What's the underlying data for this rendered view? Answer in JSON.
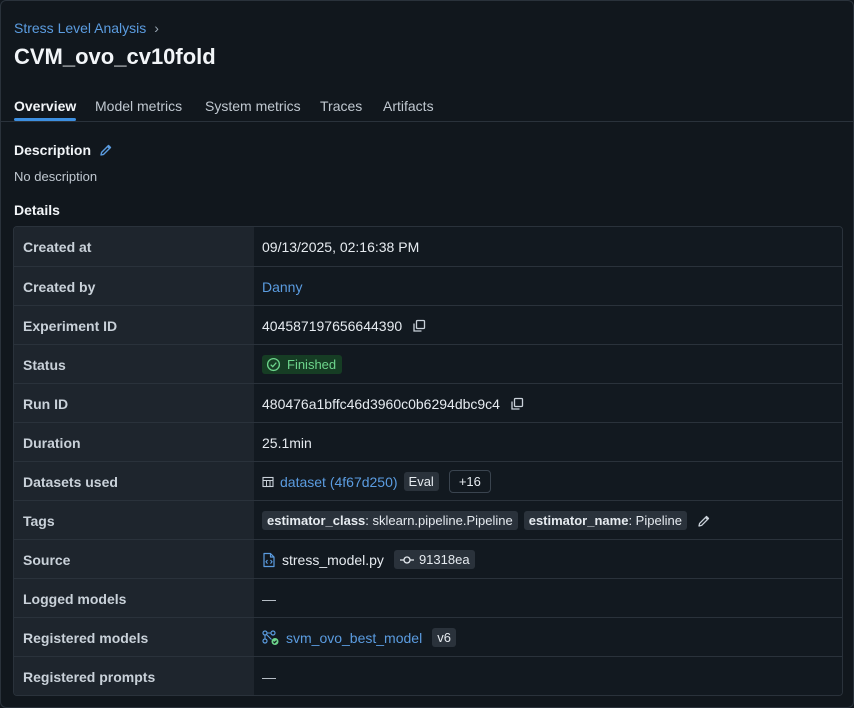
{
  "breadcrumb": {
    "experiment": "Stress Level Analysis"
  },
  "run_title": "CVM_ovo_cv10fold",
  "tabs": [
    "Overview",
    "Model metrics",
    "System metrics",
    "Traces",
    "Artifacts"
  ],
  "description": {
    "label": "Description",
    "value": "No description"
  },
  "details_label": "Details",
  "details": {
    "created_at": {
      "key": "Created at",
      "value": "09/13/2025, 02:16:38 PM"
    },
    "created_by": {
      "key": "Created by",
      "value": "Danny"
    },
    "experiment_id": {
      "key": "Experiment ID",
      "value": "404587197656644390"
    },
    "status": {
      "key": "Status",
      "value": "Finished"
    },
    "run_id": {
      "key": "Run ID",
      "value": "480476a1bffc46d3960c0b6294dbc9c4"
    },
    "duration": {
      "key": "Duration",
      "value": "25.1min"
    },
    "datasets_used": {
      "key": "Datasets used",
      "dataset": "dataset (4f67d250)",
      "context": "Eval",
      "more": "+16"
    },
    "tags": {
      "key": "Tags",
      "items": [
        {
          "name": "estimator_class",
          "value": "sklearn.pipeline.Pipeline"
        },
        {
          "name": "estimator_name",
          "value": "Pipeline"
        }
      ]
    },
    "source": {
      "key": "Source",
      "file": "stress_model.py",
      "commit": "91318ea"
    },
    "logged_models": {
      "key": "Logged models",
      "value": "—"
    },
    "registered_models": {
      "key": "Registered models",
      "model": "svm_ovo_best_model",
      "version": "v6"
    },
    "registered_prompts": {
      "key": "Registered prompts",
      "value": "—"
    }
  },
  "colors": {
    "link": "#5b9ce0",
    "accent": "#3d8fe0",
    "success": "#6dd58c",
    "background": "#11171d"
  },
  "icons": [
    "chevron-right-icon",
    "pencil-icon",
    "copy-icon",
    "check-circle-icon",
    "table-icon",
    "file-code-icon",
    "git-commit-icon",
    "model-icon"
  ]
}
